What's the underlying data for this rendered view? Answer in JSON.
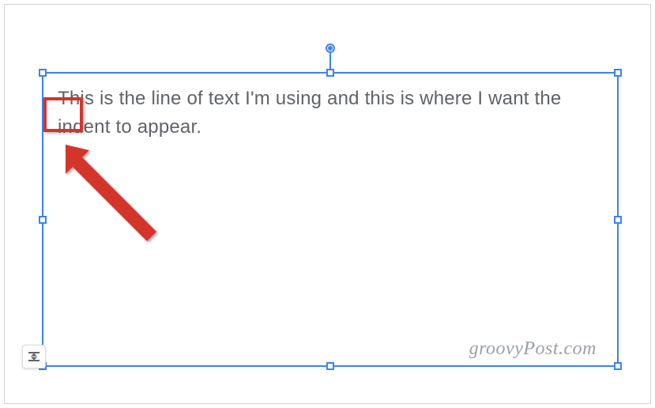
{
  "textbox": {
    "content": "This is the line of text I'm using and this is where I want the indent to appear."
  },
  "watermark": {
    "text": "groovyPost.com"
  },
  "colors": {
    "selection_border": "#3b82f6",
    "annotation_red": "#d4352a",
    "text_color": "#5f6368"
  },
  "annotation": {
    "highlight_target": "cursor-position",
    "arrow_points_to": "indent-location"
  }
}
